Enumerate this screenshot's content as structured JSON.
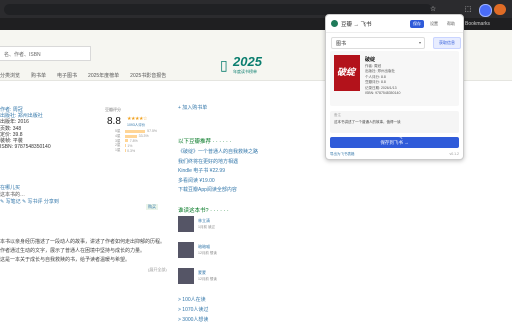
{
  "browser": {
    "bookmark_label": "All Bookmarks",
    "toolbar_icons": [
      "star-icon",
      "extension-icon",
      "puzzle-icon",
      "profile-icon",
      "menu-icon"
    ]
  },
  "site": {
    "search_placeholder": "名、作者、ISBN",
    "nav": [
      "分类浏览",
      "购书单",
      "电子图书",
      "2025年度榜单",
      "2025书影音报告"
    ],
    "logo": {
      "year": "2025",
      "sub": "年度读书榜单"
    }
  },
  "book": {
    "info_lines": [
      "作者: 周冠",
      "出版社: 郑州出版社",
      "出版年: 2016",
      "页数: 348",
      "定价: 39.8",
      "装帧: 平装",
      "ISBN: 9787548350140"
    ],
    "rating": {
      "title": "豆瓣评分",
      "score": "8.8",
      "stars": "★★★★☆",
      "count": "1093人评价",
      "distribution": [
        {
          "label": "5星",
          "pct": 57.5
        },
        {
          "label": "4星",
          "pct": 33.3
        },
        {
          "label": "3星",
          "pct": 7.8
        },
        {
          "label": "2星",
          "pct": 1.0
        },
        {
          "label": "1星",
          "pct": 0.3
        }
      ]
    },
    "actions": {
      "want": "想读",
      "reading": "在读",
      "read": "读过",
      "buy": "购买",
      "share": "分享到"
    },
    "add_list": "+ 加入购书单",
    "intro_lines": [
      "在哪儿买",
      "这本书的…",
      "✎ 写笔记  ✎ 写书评  分享到"
    ],
    "desc_lines": [
      "本书以亲身经历描述了一段动人的故事，讲述了作者如何走出抑郁的历程。",
      "作者通过生动的文字，展示了普通人在困境中坚持与成长的力量。",
      "这是一本关于成长与自我救赎的书，给予读者温暖与希望。"
    ],
    "desc_more": "(展开全部)"
  },
  "sidebar": {
    "rec_title": "以下豆瓣推荐 · · · · · ·",
    "rec_items": [
      "《破绽》一个普通人的自我救赎之路",
      "我们终将在更好的地方相遇",
      "Kindle 电子书 ¥22.99",
      "多看阅读 ¥19.00",
      "下载豆瓣App阅读全部内容"
    ],
    "reading_title": "谁读这本书? · · · · · ·",
    "readers": [
      {
        "name": "林立清",
        "status": "1月前 读过"
      },
      {
        "name": "暗暗喵",
        "status": "12月前 想读"
      },
      {
        "name": "蒙蒙",
        "status": "12月前 想读"
      }
    ],
    "more_links": [
      "> 100人在读",
      "> 1070人读过",
      "> 3000人想读"
    ]
  },
  "popup": {
    "title": "豆瓣 → 飞书",
    "tabs": [
      "保存",
      "设置",
      "帮助"
    ],
    "select_value": "图书",
    "sync_label": "获取信息",
    "book_title": "破绽",
    "cover_text": "破绽",
    "meta": [
      "作者: 周冠",
      "出版社: 郑州出版社",
      "个人评分: 8.8",
      "豆瓣评分: 8.8",
      "记录日期: 2026/1/13",
      "ISBN: 9787548350140"
    ],
    "note_label": "备注",
    "note_text": "这本书讲述了一个普通人的故事，值得一读",
    "save_label": "保存到飞书 →",
    "footer_link": "导出为飞书表格",
    "version": "v0.1.2"
  },
  "colors": {
    "accent": "#2f5bd9",
    "link": "#3377aa",
    "brand_green": "#0b7e6f",
    "star": "#f1a11e"
  }
}
